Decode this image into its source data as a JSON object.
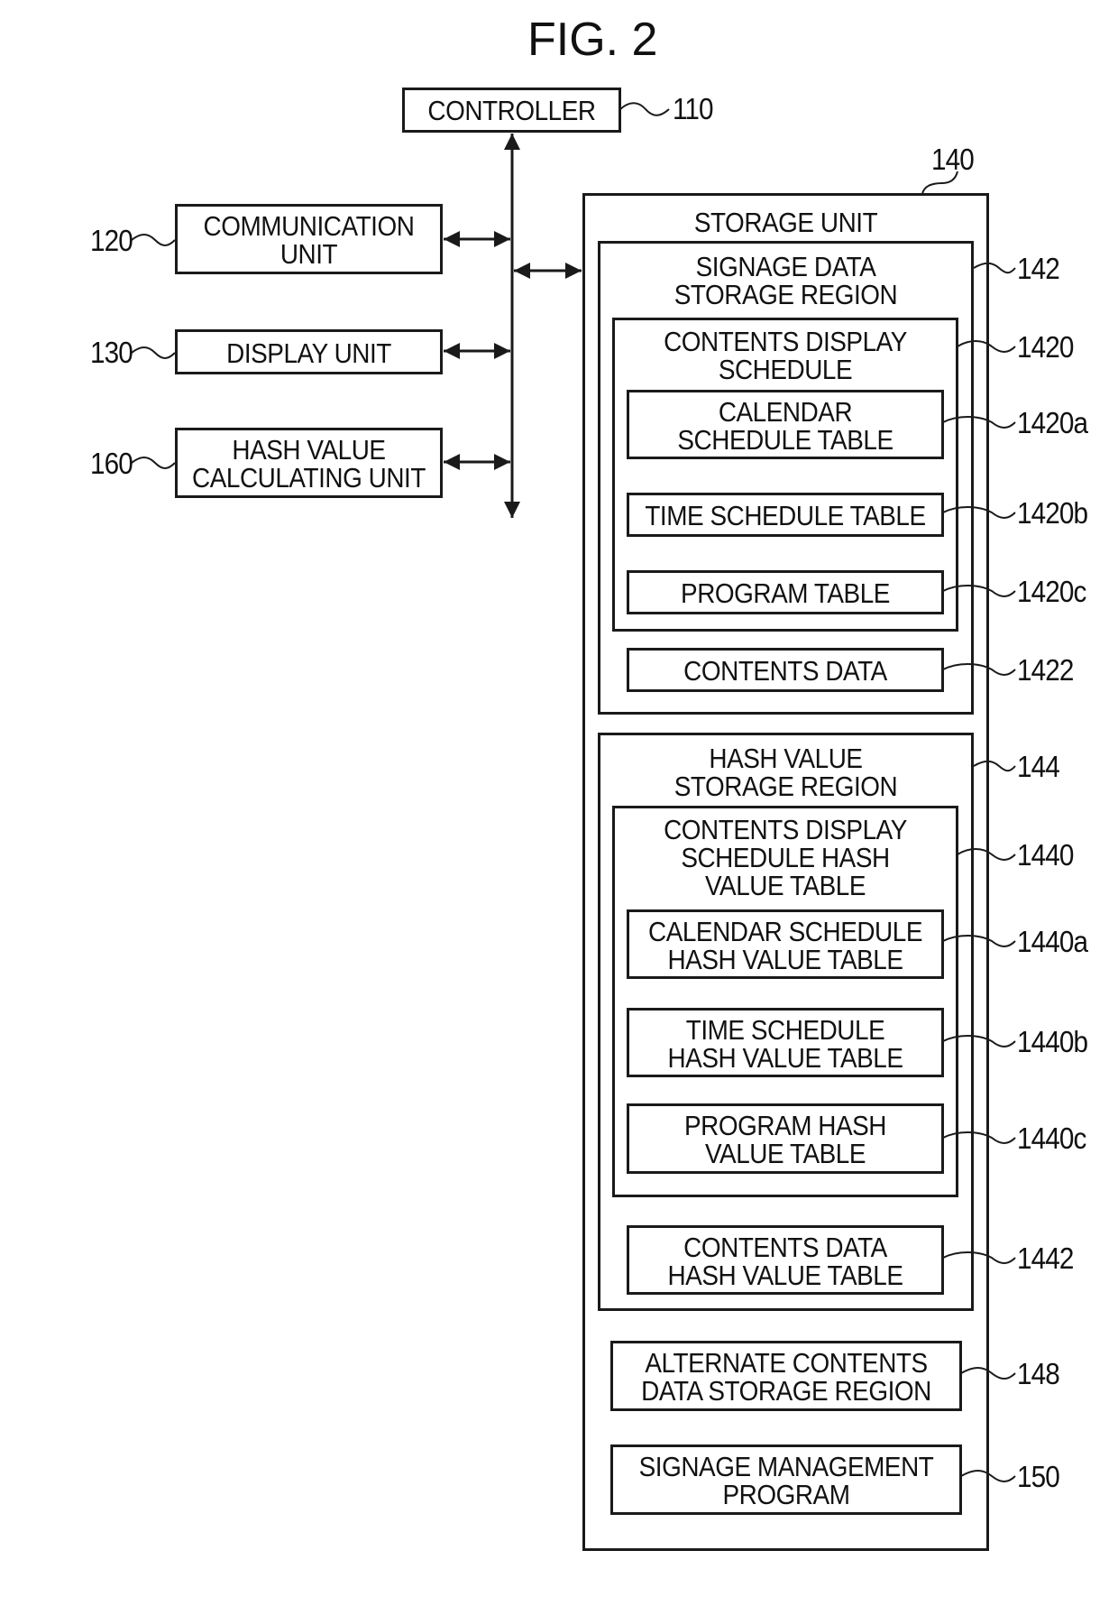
{
  "figure": {
    "title": "FIG. 2"
  },
  "left_units": {
    "controller": {
      "label": "CONTROLLER",
      "ref": "110"
    },
    "communication": {
      "label": "COMMUNICATION\nUNIT",
      "ref": "120"
    },
    "display": {
      "label": "DISPLAY UNIT",
      "ref": "130"
    },
    "hash_calc": {
      "label": "HASH VALUE\nCALCULATING UNIT",
      "ref": "160"
    }
  },
  "storage": {
    "label": "STORAGE UNIT",
    "ref": "140",
    "signage_region": {
      "label": "SIGNAGE DATA\nSTORAGE REGION",
      "ref": "142",
      "schedule": {
        "label": "CONTENTS DISPLAY\nSCHEDULE",
        "ref": "1420",
        "calendar": {
          "label": "CALENDAR\nSCHEDULE TABLE",
          "ref": "1420a"
        },
        "time": {
          "label": "TIME SCHEDULE TABLE",
          "ref": "1420b"
        },
        "program": {
          "label": "PROGRAM TABLE",
          "ref": "1420c"
        }
      },
      "contents": {
        "label": "CONTENTS DATA",
        "ref": "1422"
      }
    },
    "hash_region": {
      "label": "HASH VALUE\nSTORAGE REGION",
      "ref": "144",
      "schedule_hash": {
        "label": "CONTENTS DISPLAY\nSCHEDULE HASH\nVALUE TABLE",
        "ref": "1440",
        "calendar_hash": {
          "label": "CALENDAR SCHEDULE\nHASH VALUE TABLE",
          "ref": "1440a"
        },
        "time_hash": {
          "label": "TIME SCHEDULE\nHASH VALUE TABLE",
          "ref": "1440b"
        },
        "program_hash": {
          "label": "PROGRAM HASH\nVALUE TABLE",
          "ref": "1440c"
        }
      },
      "contents_hash": {
        "label": "CONTENTS DATA\nHASH VALUE TABLE",
        "ref": "1442"
      }
    },
    "alternate": {
      "label": "ALTERNATE CONTENTS\nDATA STORAGE REGION",
      "ref": "148"
    },
    "management": {
      "label": "SIGNAGE MANAGEMENT\nPROGRAM",
      "ref": "150"
    }
  }
}
